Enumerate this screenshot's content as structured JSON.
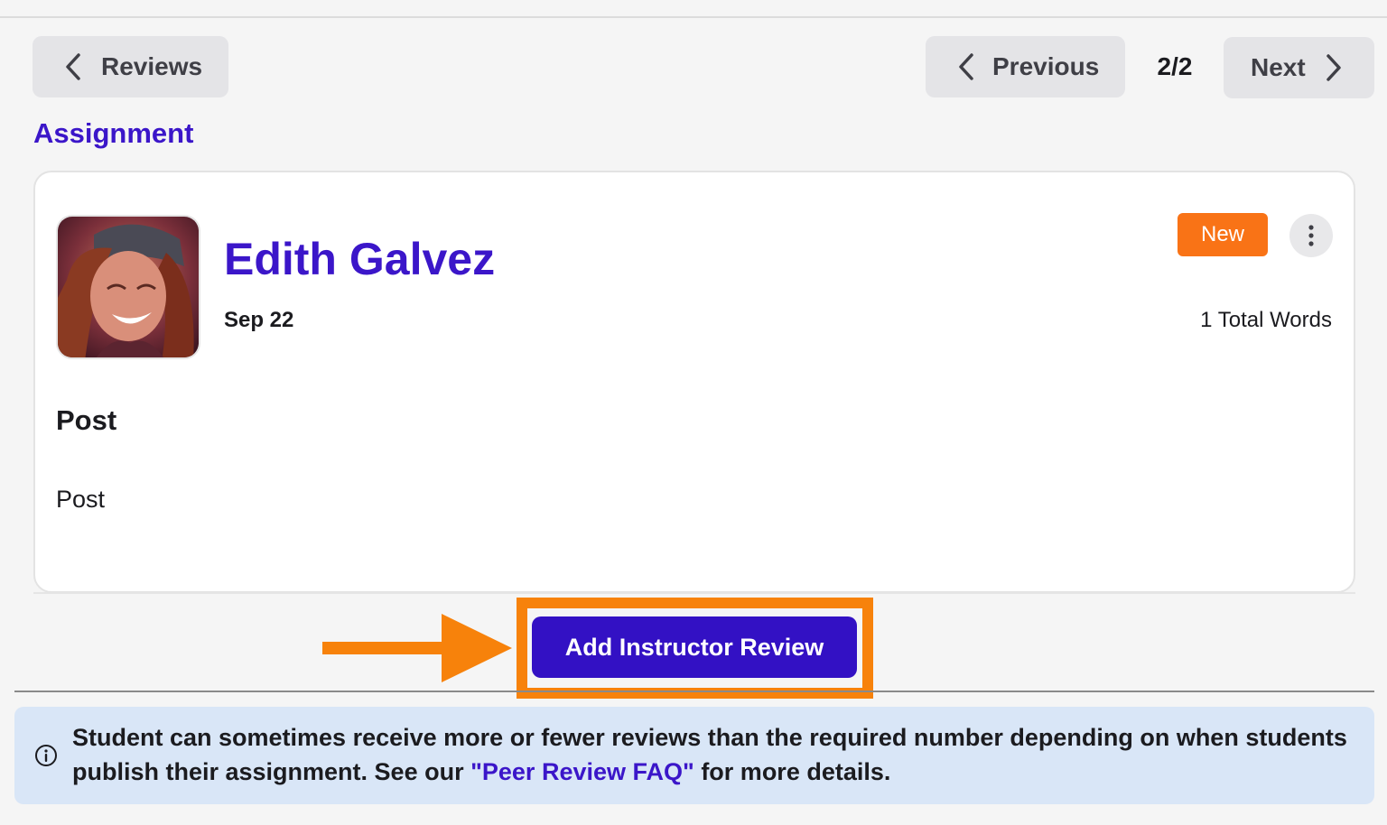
{
  "nav": {
    "back_label": "Reviews",
    "previous_label": "Previous",
    "next_label": "Next",
    "page_indicator": "2/2"
  },
  "section": {
    "title": "Assignment"
  },
  "submission": {
    "author": "Edith Galvez",
    "date": "Sep 22",
    "status_badge": "New",
    "word_count": "1 Total Words",
    "post_heading": "Post",
    "post_body": "Post"
  },
  "actions": {
    "add_review_label": "Add Instructor Review"
  },
  "info": {
    "text_before": "Student can sometimes receive more or fewer reviews than the required number depending on when students publish their assignment. See our ",
    "link_text": "\"Peer Review FAQ\"",
    "text_after": " for more details."
  },
  "icons": {
    "back": "chevron-left-icon",
    "previous": "chevron-left-icon",
    "next": "chevron-right-icon",
    "more": "more-vertical-icon",
    "info": "info-icon",
    "pointer": "arrow-right-icon"
  },
  "colors": {
    "brand": "#3b16c9",
    "primary_button": "#3311c4",
    "highlight": "#f7820b",
    "badge": "#f97316",
    "info_banner": "#d9e6f7"
  }
}
